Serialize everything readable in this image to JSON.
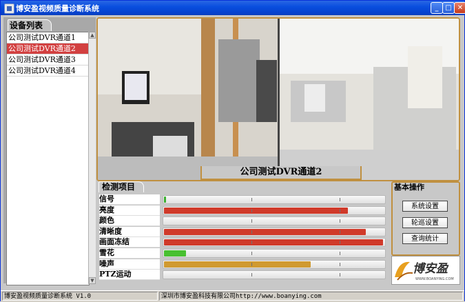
{
  "window": {
    "title": "博安盈视频质量诊断系统",
    "minimize_label": "_",
    "maximize_label": "□",
    "close_label": "✕"
  },
  "device_list": {
    "header": "设备列表",
    "items": [
      {
        "label": "公司测试DVR通道1",
        "selected": false
      },
      {
        "label": "公司测试DVR通道2",
        "selected": true
      },
      {
        "label": "公司测试DVR通道3",
        "selected": false
      },
      {
        "label": "公司测试DVR通道4",
        "selected": false
      }
    ]
  },
  "video": {
    "channel_title": "公司测试DVR通道2"
  },
  "detection": {
    "header": "检测项目",
    "items": [
      {
        "label": "信号",
        "level": 0.01,
        "color": "#3cb030"
      },
      {
        "label": "亮度",
        "level": 0.84,
        "color": "#d03a2a"
      },
      {
        "label": "颜色",
        "level": 0.0,
        "color": "#d03a2a"
      },
      {
        "label": "清晰度",
        "level": 0.92,
        "color": "#d03a2a"
      },
      {
        "label": "画面冻结",
        "level": 1.0,
        "color": "#d03a2a"
      },
      {
        "label": "雪花",
        "level": 0.1,
        "color": "#48c030"
      },
      {
        "label": "噪声",
        "level": 0.67,
        "color": "#d09a30"
      },
      {
        "label": "PTZ运动",
        "level": 0.0,
        "color": "#d03a2a"
      }
    ]
  },
  "operations": {
    "header": "基本操作",
    "buttons": [
      "系统设置",
      "轮巡设置",
      "查询统计"
    ]
  },
  "logo": {
    "text": "博安盈",
    "url_text": "WWW.BOANYING.COM"
  },
  "status": {
    "app": "博安盈视频质量诊断系统 V1.0",
    "company": "深圳市博安盈科技有限公司http://www.boanying.com"
  },
  "colors": {
    "accent_border": "#c09040",
    "title_bar": "#0a4fdf",
    "selected_item": "#d24040"
  }
}
